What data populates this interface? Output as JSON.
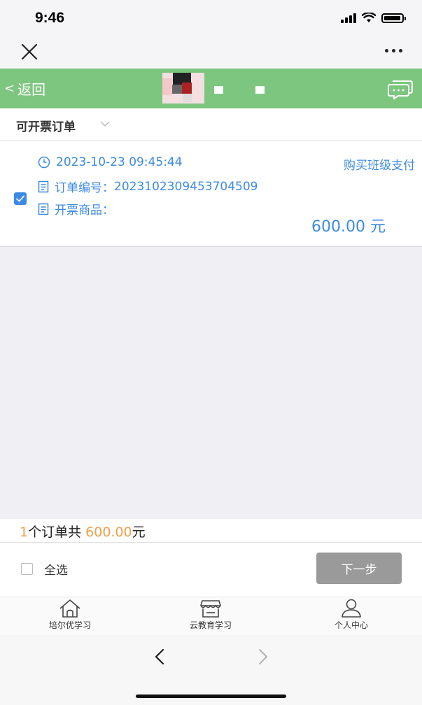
{
  "status": {
    "time": "9:46"
  },
  "nav": {
    "back_label": "返回",
    "back_chevron": "<"
  },
  "filter": {
    "label": "可开票订单"
  },
  "order": {
    "checked": true,
    "time": "2023-10-23 09:45:44",
    "type": "购买班级支付",
    "number_label": "订单编号：",
    "number": "202310230945370450 9",
    "goods_label": "开票商品：",
    "amount": "600.00 元"
  },
  "summary": {
    "count": "1",
    "count_suffix": "个订单共 ",
    "total": "600.00",
    "unit": "元"
  },
  "actions": {
    "select_all": "全选",
    "next": "下一步"
  },
  "tabs": [
    {
      "label": "培尔优学习",
      "icon": "home-icon"
    },
    {
      "label": "云教育学习",
      "icon": "store-icon"
    },
    {
      "label": "个人中心",
      "icon": "user-icon"
    }
  ],
  "colors": {
    "nav_green": "#7dc67f",
    "link_blue": "#3d8ae5",
    "orange": "#f0a04a",
    "button_gray": "#9a9a9a"
  }
}
